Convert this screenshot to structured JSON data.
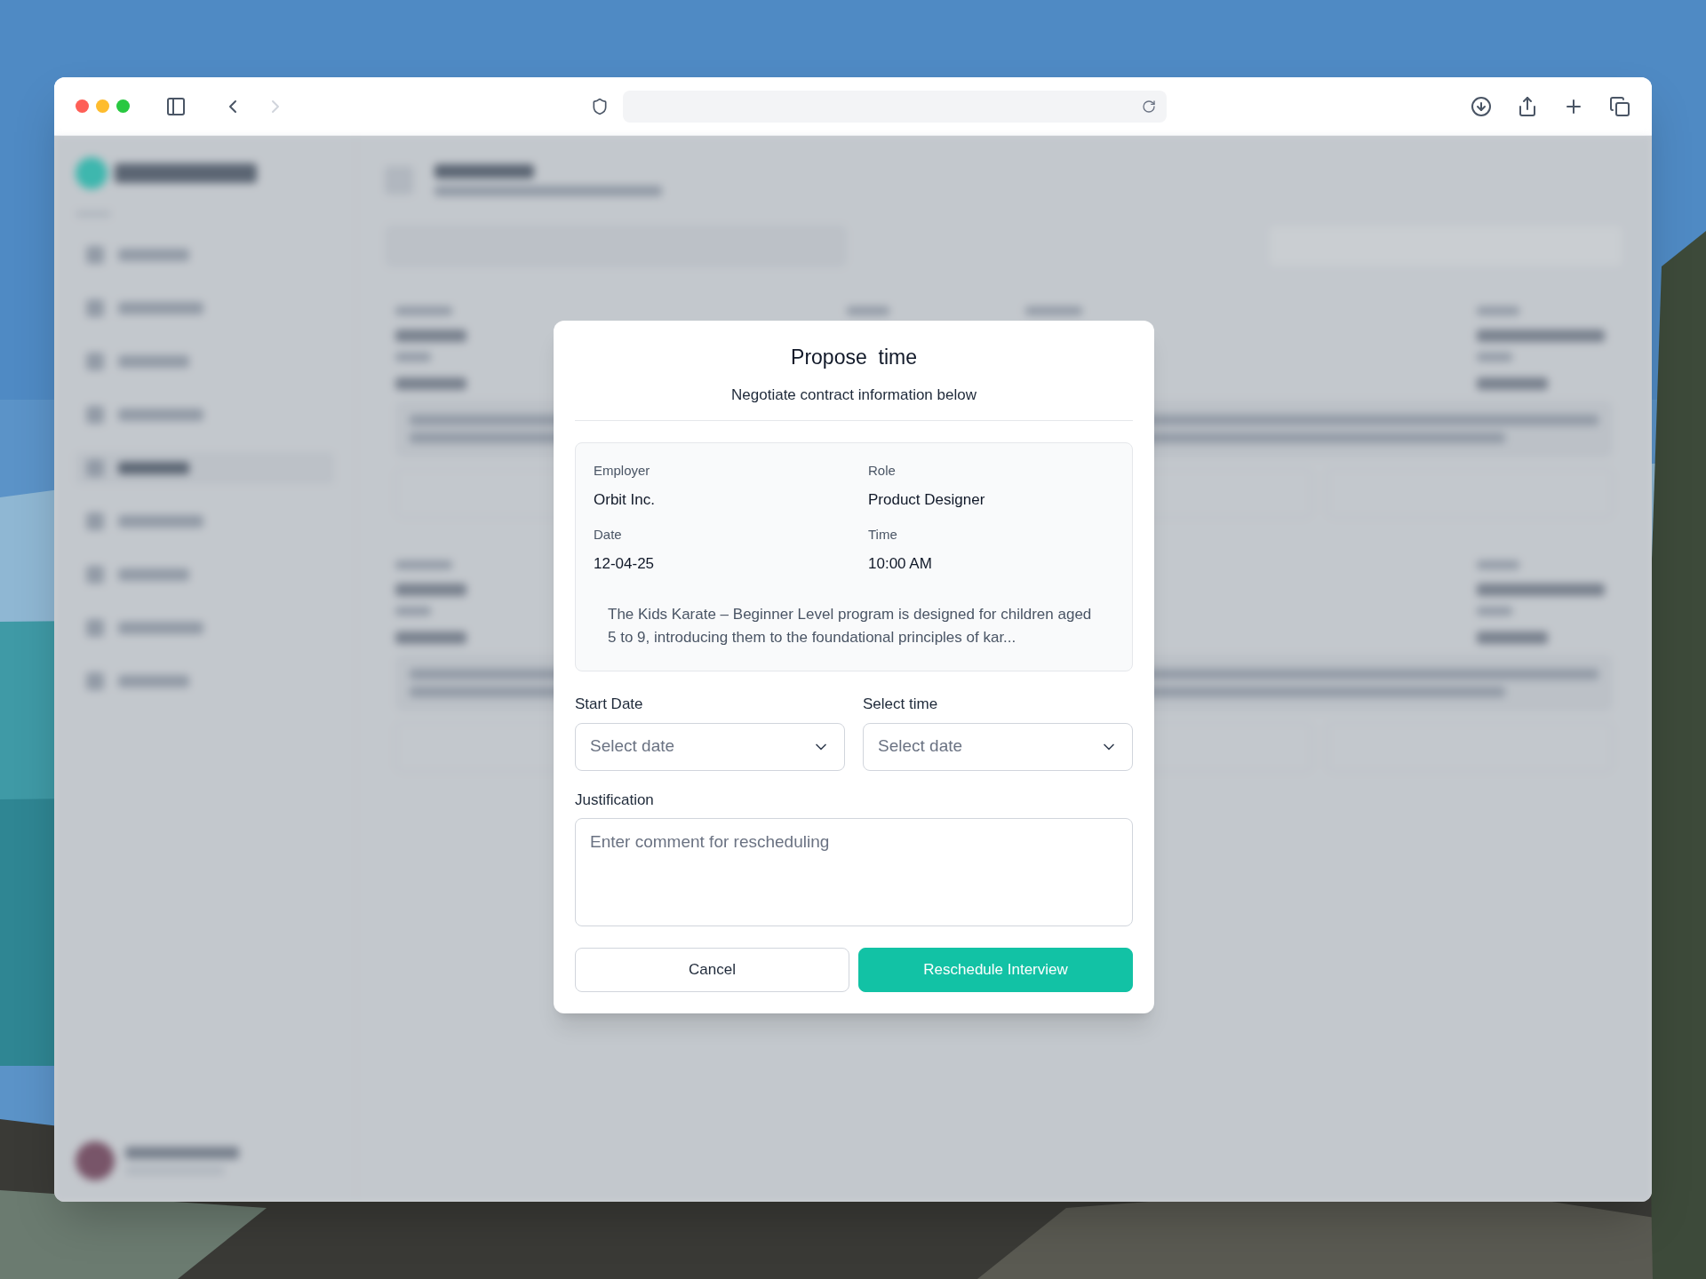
{
  "dialog": {
    "title": "Propose  time",
    "subtitle": "Negotiate contract information below",
    "details": [
      {
        "label": "Employer",
        "value": "Orbit Inc."
      },
      {
        "label": "Role",
        "value": "Product Designer"
      },
      {
        "label": "Date",
        "value": "12-04-25"
      },
      {
        "label": "Time",
        "value": "10:00 AM"
      }
    ],
    "description": "The Kids Karate – Beginner Level program is designed for children aged 5 to 9, introducing them to the foundational principles of kar...",
    "fields": [
      {
        "label": "Start Date",
        "placeholder": "Select date"
      },
      {
        "label": "Select time",
        "placeholder": "Select date"
      }
    ],
    "justification": {
      "label": "Justification",
      "placeholder": "Enter comment for rescheduling"
    },
    "buttons": [
      {
        "kind": "secondary",
        "label": "Cancel"
      },
      {
        "kind": "primary",
        "label": "Reschedule Interview"
      }
    ]
  }
}
